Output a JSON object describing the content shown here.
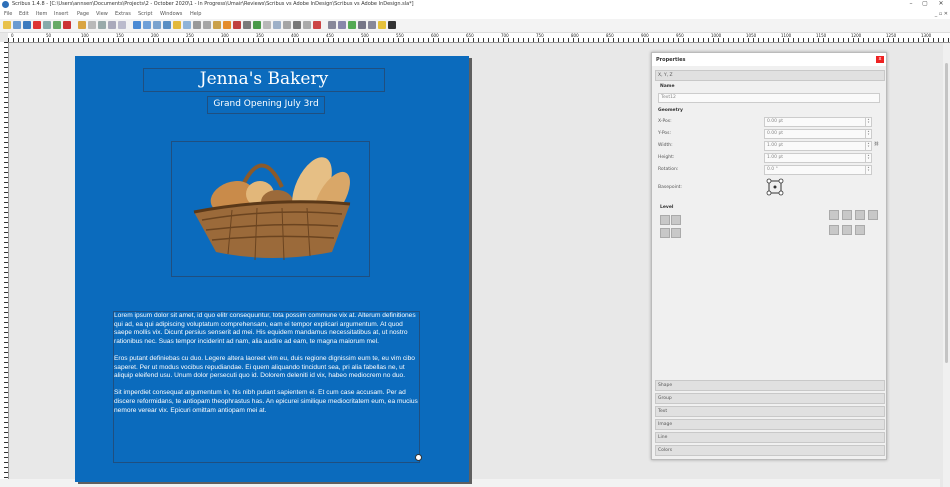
{
  "window": {
    "title": "Scribus 1.4.8 - [C:\\Users\\annsen\\Documents\\Projects\\2 - October 2020\\1 - In Progress\\Umair\\Reviews\\Scribus vs Adobe InDesign\\Scribus vs Adobe InDesign.sla*]",
    "minimize": "–",
    "maximize": "▢",
    "close": "✕"
  },
  "menu": {
    "items": [
      "File",
      "Edit",
      "Item",
      "Insert",
      "Page",
      "View",
      "Extras",
      "Script",
      "Windows",
      "Help"
    ],
    "right_controls": "_ ▫ ✕"
  },
  "ruler": {
    "labels": [
      "0",
      "50",
      "100",
      "150",
      "200",
      "250",
      "300",
      "350",
      "400",
      "450",
      "500",
      "550",
      "600",
      "650",
      "700",
      "750",
      "800",
      "850",
      "900",
      "950",
      "1000",
      "1050",
      "1100",
      "1150",
      "1200",
      "1250",
      "1300"
    ]
  },
  "document": {
    "title": "Jenna's Bakery",
    "subtitle": "Grand Opening July 3rd",
    "paragraphs": [
      "Lorem ipsum dolor sit amet, id quo elitr consequuntur, tota possim commune vix at. Alterum definitiones qui ad, ea qui adipiscing voluptatum comprehensam, eam ei tempor explicari argumentum. At quod saepe mollis vix. Dicunt persius senserit ad mei. His equidem mandamus necessitatibus at, ut nostro rationibus nec. Suas tempor inciderint ad nam, alia audire ad eam, te magna maiorum mel.",
      "Eros putant definiebas cu duo. Legere altera laoreet vim eu, duis regione dignissim eum te, eu vim cibo saperet. Per ut modus vocibus repudiandae. Ei quem aliquando tincidunt sea, pri alia fabellas ne, ut aliquip eleifend usu. Unum dolor persecuti quo id. Dolorem deleniti id vix, habeo mediocrem no duo.",
      "Sit imperdiet consequat argumentum in, his nibh putant sapientem ei. Et cum case accusam. Per ad discere reformidans, te antiopam theophrastus has. An epicurei similique mediocritatem eum, ea mucius nemore verear vix. Epicuri omittam antiopam mei at."
    ],
    "colors": {
      "page": "#0b6bbd",
      "text": "#ffffff"
    }
  },
  "properties": {
    "title": "Properties",
    "close_label": "x",
    "xyz_tab": "X, Y, Z",
    "name_label": "Name",
    "name_value": "Text12",
    "geometry_label": "Geometry",
    "xpos_label": "X-Pos:",
    "xpos_value": "0.00 pt",
    "ypos_label": "Y-Pos:",
    "ypos_value": "0.00 pt",
    "width_label": "Width:",
    "width_value": "1.00 pt",
    "height_label": "Height:",
    "height_value": "1.00 pt",
    "rotation_label": "Rotation:",
    "rotation_value": "0.0 °",
    "basepoint_label": "Basepoint:",
    "level_label": "Level",
    "tabs": [
      "Shape",
      "Group",
      "Text",
      "Image",
      "Line",
      "Colors"
    ]
  }
}
